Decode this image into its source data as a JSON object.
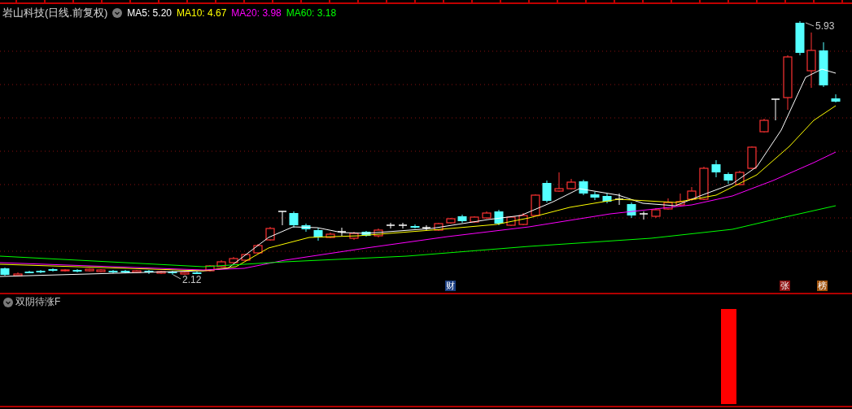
{
  "header": {
    "title": "岩山科技(日线.前复权)",
    "moving_averages": [
      {
        "label": "MA5: 5.20",
        "color": "#ffffff"
      },
      {
        "label": "MA10: 4.67",
        "color": "#ffff00"
      },
      {
        "label": "MA20: 3.98",
        "color": "#ff00ff"
      },
      {
        "label": "MA60: 3.18",
        "color": "#00ff00"
      }
    ]
  },
  "price_labels": {
    "high": "5.93",
    "low": "2.12"
  },
  "event_markers": [
    {
      "label": "财",
      "color": "#1c3f82"
    },
    {
      "label": "张",
      "color": "#8c1010"
    },
    {
      "label": "榜",
      "color": "#a2540e"
    }
  ],
  "indicator": {
    "title": "双阴待涨F"
  }
}
